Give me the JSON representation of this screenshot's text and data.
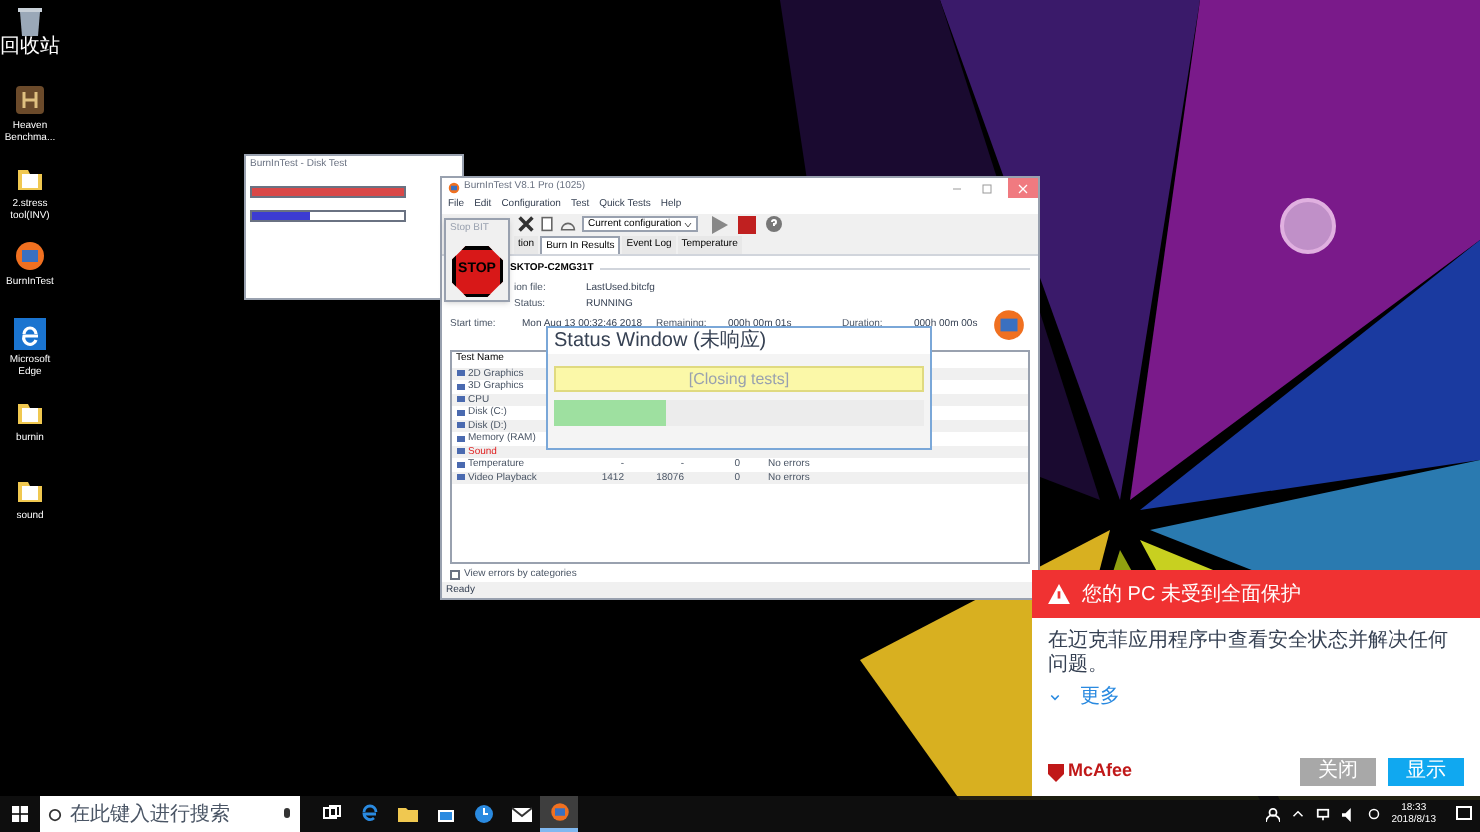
{
  "desktop_icons": [
    {
      "label": "回收站",
      "kind": "recycle"
    },
    {
      "label": "Heaven Benchma...",
      "kind": "app"
    },
    {
      "label": "2.stress tool(INV)",
      "kind": "folder"
    },
    {
      "label": "BurnInTest",
      "kind": "burnin"
    },
    {
      "label": "Microsoft Edge",
      "kind": "edge"
    },
    {
      "label": "burnin",
      "kind": "folder"
    },
    {
      "label": "sound",
      "kind": "folder"
    }
  ],
  "disk_test_window": {
    "title": "BurnInTest - Disk Test",
    "bars": [
      {
        "level": 1,
        "color": "#d94848"
      },
      {
        "level": 0.38,
        "color": "#3c3cd2"
      }
    ]
  },
  "main_window": {
    "title": "BurnInTest V8.1 Pro (1025)",
    "menu": [
      "File",
      "Edit",
      "Configuration",
      "Test",
      "Quick Tests",
      "Help"
    ],
    "stop_popup": {
      "label": "Stop BIT",
      "button": "STOP"
    },
    "config_select": {
      "value": "Current configuration"
    },
    "tabs": [
      {
        "label": "tion",
        "selected": false
      },
      {
        "label": "Burn In Results",
        "selected": true
      },
      {
        "label": "Event Log",
        "selected": false
      },
      {
        "label": "Temperature",
        "selected": false
      }
    ],
    "machine": "SKTOP-C2MG31T",
    "info_rows": [
      [
        {
          "label": "ion file:",
          "value": "LastUsed.bitcfg"
        },
        {
          "label": "Status:",
          "value": "RUNNING"
        }
      ],
      [
        {
          "label": "Start time:",
          "value": "Mon Aug 13 00:32:46 2018"
        },
        {
          "label": "Remaining:",
          "value": "000h 00m 01s"
        },
        {
          "label": "Duration:",
          "value": "000h 00m 00s"
        }
      ]
    ],
    "table": {
      "columns": [
        "Test Name"
      ],
      "rows": [
        {
          "name": "2D Graphics",
          "failed": false,
          "cells": []
        },
        {
          "name": "3D Graphics",
          "failed": false,
          "cells": []
        },
        {
          "name": "CPU",
          "failed": false,
          "cells": []
        },
        {
          "name": "Disk (C:)",
          "failed": false,
          "cells": []
        },
        {
          "name": "Disk (D:)",
          "failed": false,
          "cells": []
        },
        {
          "name": "Memory (RAM)",
          "failed": false,
          "cells": []
        },
        {
          "name": "Sound",
          "failed": true,
          "cells": []
        },
        {
          "name": "Temperature",
          "failed": false,
          "cells": [
            "-",
            "-",
            "0",
            "No errors"
          ]
        },
        {
          "name": "Video Playback",
          "failed": false,
          "cells": [
            "1412",
            "18076",
            "0",
            "No errors"
          ]
        }
      ]
    },
    "view_errors": {
      "label": "View errors by categories",
      "checked": false
    },
    "status_bar": "Ready"
  },
  "status_window": {
    "title": "Status Window (未响应)",
    "message": "[Closing tests]",
    "level": 0.3
  },
  "mcafee_alert": {
    "title": "您的 PC 未受到全面保护",
    "message": "在迈克菲应用程序中查看安全状态并解决任何问题。",
    "more": "更多",
    "brand": "McAfee",
    "buttons": [
      {
        "label": "关闭",
        "kind": "secondary"
      },
      {
        "label": "显示",
        "kind": "primary"
      }
    ]
  },
  "taskbar": {
    "search_placeholder": "在此键入进行搜索",
    "apps": [
      {
        "kind": "taskview",
        "active": false
      },
      {
        "kind": "edge",
        "active": false
      },
      {
        "kind": "explorer",
        "active": false
      },
      {
        "kind": "store",
        "active": false
      },
      {
        "kind": "clock",
        "active": false
      },
      {
        "kind": "mail",
        "active": false
      },
      {
        "kind": "burnin",
        "active": true
      }
    ],
    "time": "18:33",
    "date": "2018/8/13"
  }
}
